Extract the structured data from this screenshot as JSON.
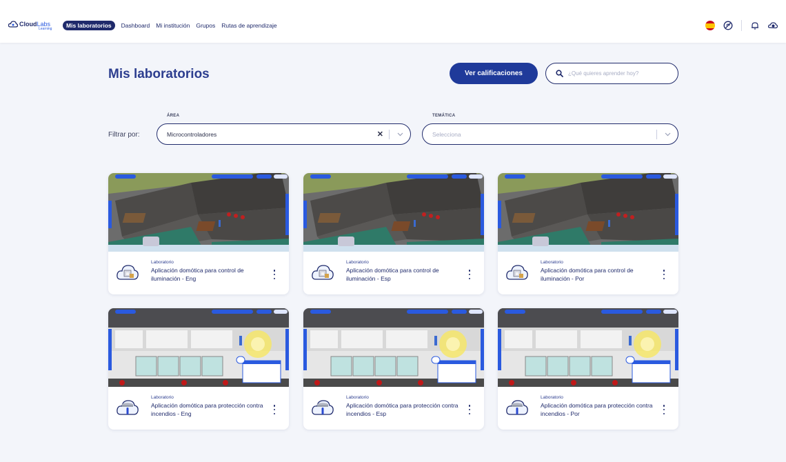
{
  "brand": {
    "name_bold": "Cloud",
    "name_light": "Labs",
    "sub": "Learning"
  },
  "nav": {
    "items": [
      {
        "label": "Mis laboratorios",
        "active": true
      },
      {
        "label": "Dashboard",
        "active": false
      },
      {
        "label": "Mi institución",
        "active": false
      },
      {
        "label": "Grupos",
        "active": false
      },
      {
        "label": "Rutas de aprendizaje",
        "active": false
      }
    ],
    "icons": [
      "spain-flag-icon",
      "accessibility-icon",
      "bell-icon",
      "user-avatar-icon"
    ]
  },
  "header": {
    "title": "Mis laboratorios",
    "grades_button": "Ver calificaciones",
    "search_placeholder": "¿Qué quieres aprender hoy?"
  },
  "filters": {
    "label": "Filtrar por:",
    "area": {
      "caption": "ÁREA",
      "value": "Microcontroladores"
    },
    "tematica": {
      "caption": "TEMÁTICA",
      "placeholder": "Selecciona"
    }
  },
  "cards": [
    {
      "type": "Laboratorio",
      "title": "Aplicación domótica para control de iluminación - Eng",
      "scene": "house"
    },
    {
      "type": "Laboratorio",
      "title": "Aplicación domótica para control de iluminación - Esp",
      "scene": "house"
    },
    {
      "type": "Laboratorio",
      "title": "Aplicación domótica para control de iluminación - Por",
      "scene": "house"
    },
    {
      "type": "Laboratorio",
      "title": "Aplicación domótica para protección contra incendios - Eng",
      "scene": "kitchen"
    },
    {
      "type": "Laboratorio",
      "title": "Aplicación domótica para protección contra incendios - Esp",
      "scene": "kitchen"
    },
    {
      "type": "Laboratorio",
      "title": "Aplicación domótica para protección contra incendios - Por",
      "scene": "kitchen"
    }
  ],
  "colors": {
    "primary": "#1f3a9a",
    "navy": "#1f2a6b",
    "title": "#2d3e8f",
    "background": "#f3f5fa"
  }
}
